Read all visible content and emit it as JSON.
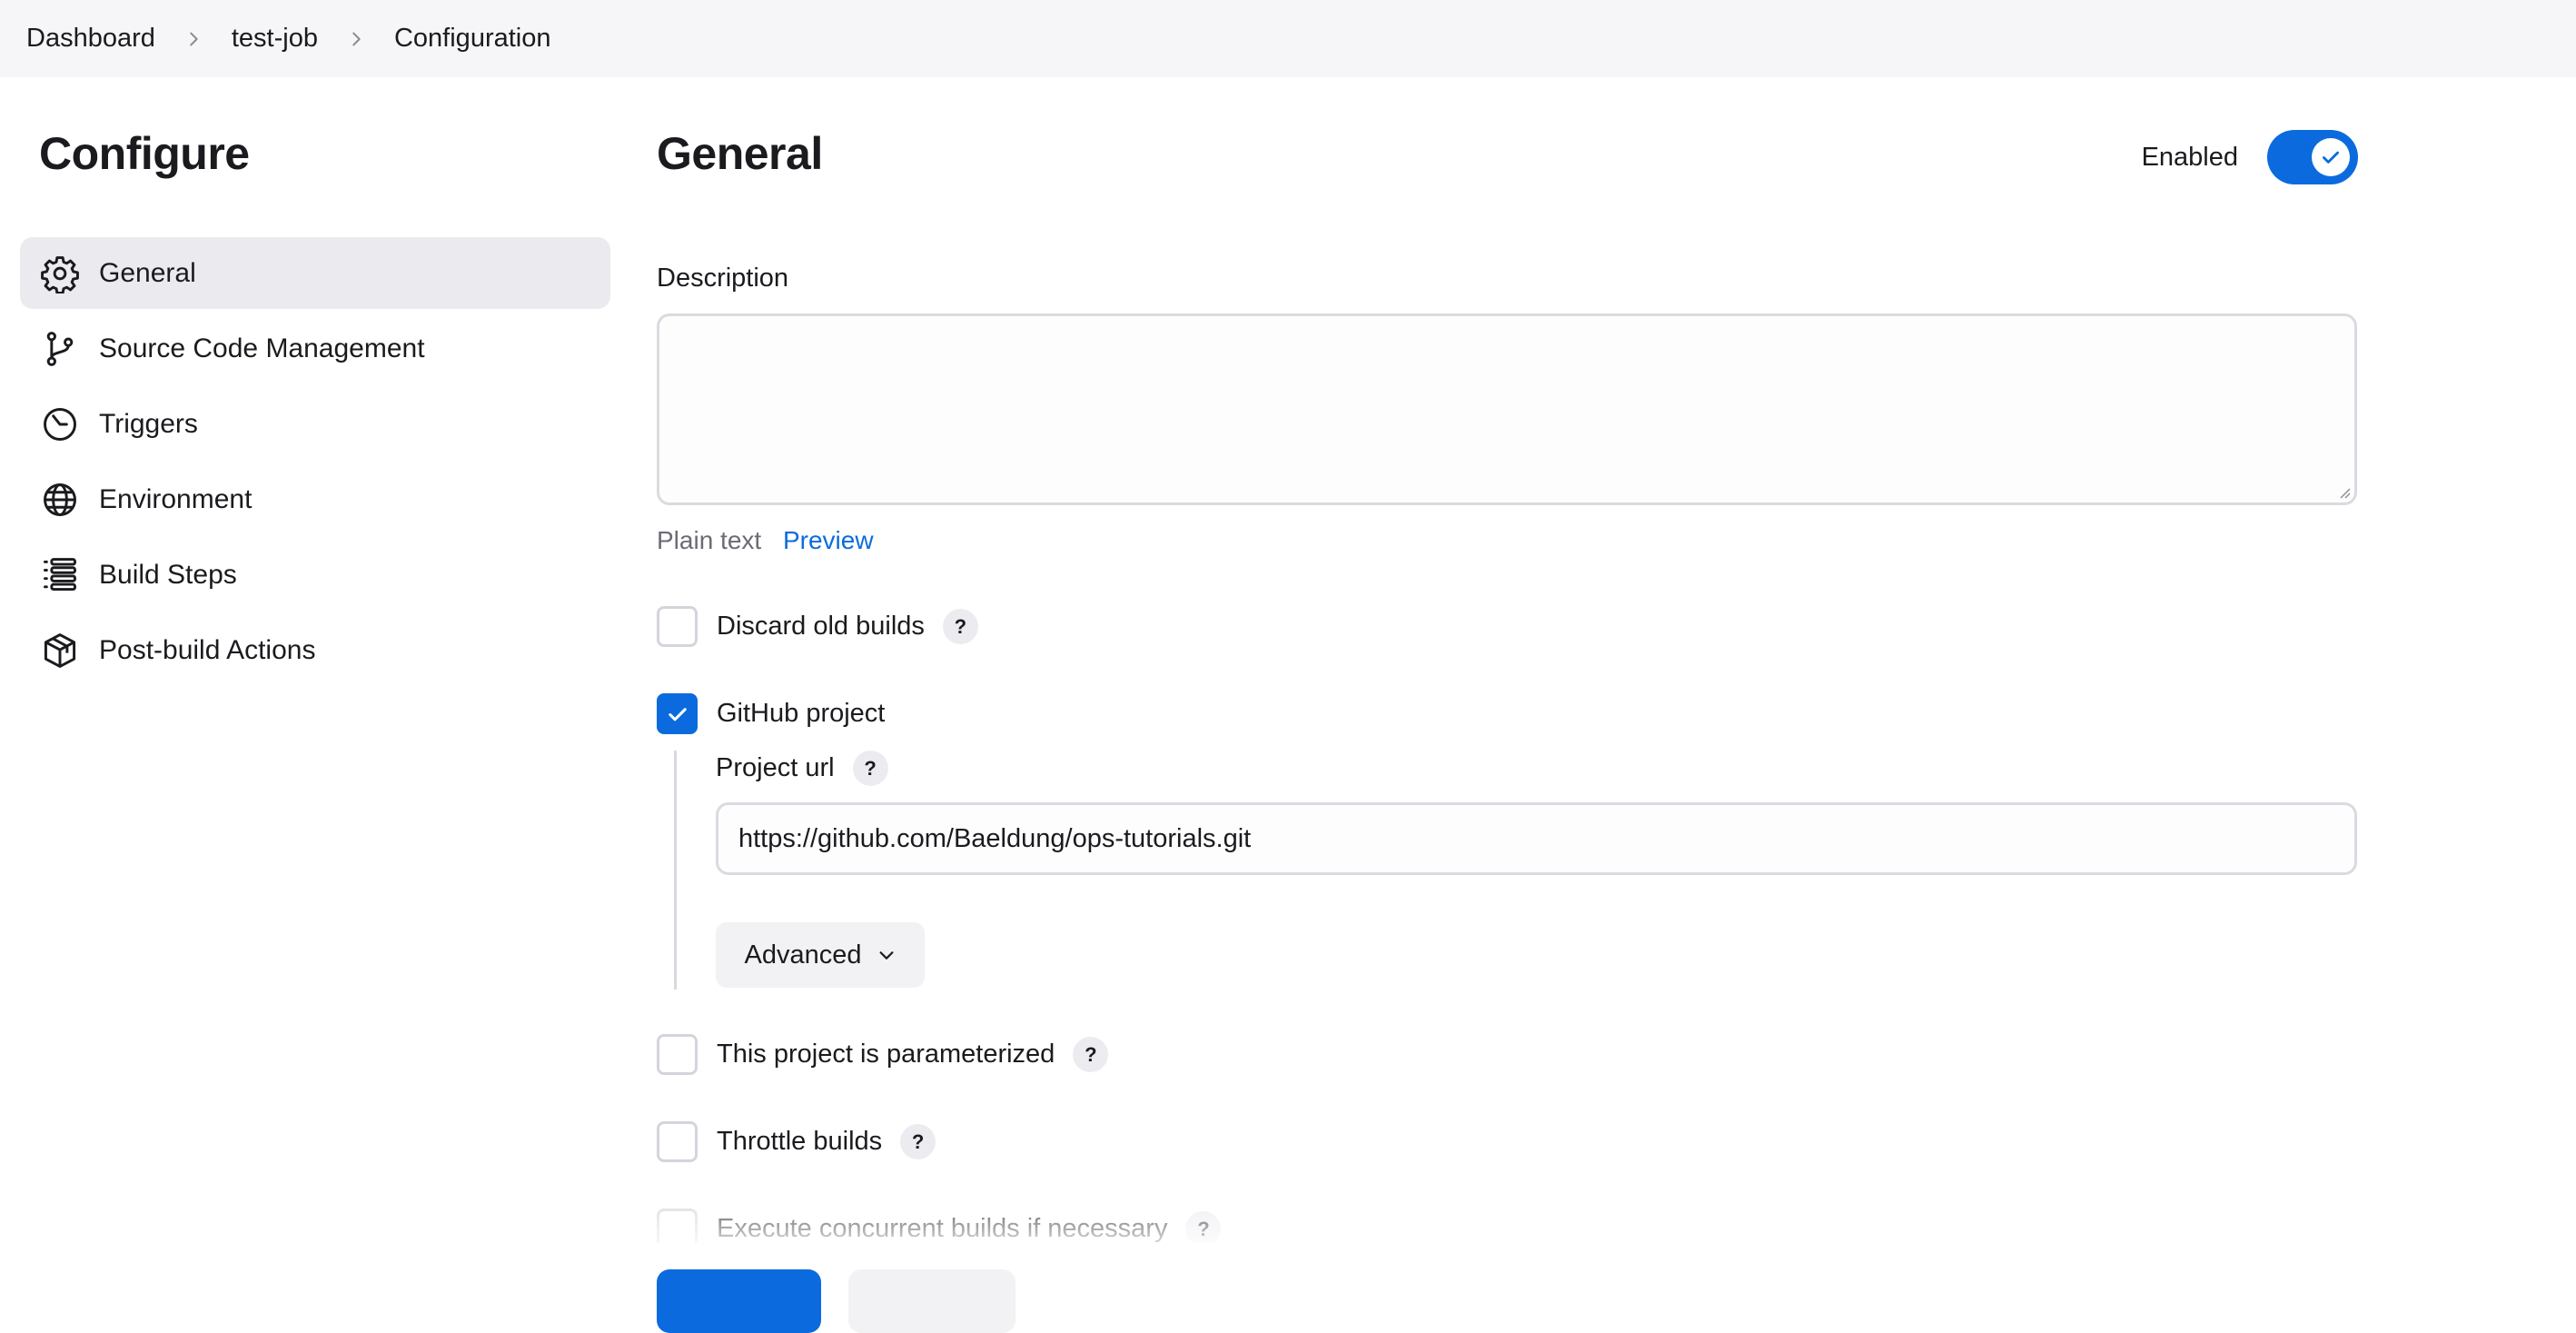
{
  "breadcrumb": {
    "items": [
      "Dashboard",
      "test-job",
      "Configuration"
    ]
  },
  "sidebar": {
    "title": "Configure",
    "items": [
      {
        "label": "General",
        "icon": "gear-icon",
        "active": true
      },
      {
        "label": "Source Code Management",
        "icon": "git-branch-icon",
        "active": false
      },
      {
        "label": "Triggers",
        "icon": "clock-icon",
        "active": false
      },
      {
        "label": "Environment",
        "icon": "globe-icon",
        "active": false
      },
      {
        "label": "Build Steps",
        "icon": "list-icon",
        "active": false
      },
      {
        "label": "Post-build Actions",
        "icon": "package-icon",
        "active": false
      }
    ]
  },
  "main": {
    "title": "General",
    "enabled_label": "Enabled",
    "enabled": true,
    "description": {
      "label": "Description",
      "value": "",
      "plain_text": "Plain text",
      "preview": "Preview"
    },
    "options": {
      "discard_old_builds": {
        "label": "Discard old builds",
        "checked": false,
        "help": "?"
      },
      "github_project": {
        "label": "GitHub project",
        "checked": true
      },
      "parameterized": {
        "label": "This project is parameterized",
        "checked": false,
        "help": "?"
      },
      "throttle": {
        "label": "Throttle builds",
        "checked": false,
        "help": "?"
      },
      "concurrent": {
        "label": "Execute concurrent builds if necessary",
        "checked": false,
        "help": "?"
      }
    },
    "project_url": {
      "label": "Project url",
      "help": "?",
      "value": "https://github.com/Baeldung/ops-tutorials.git"
    },
    "advanced_label": "Advanced"
  },
  "colors": {
    "accent": "#0b6bde",
    "topbar_bg": "#f6f6f8",
    "active_item_bg": "#ebebef"
  }
}
